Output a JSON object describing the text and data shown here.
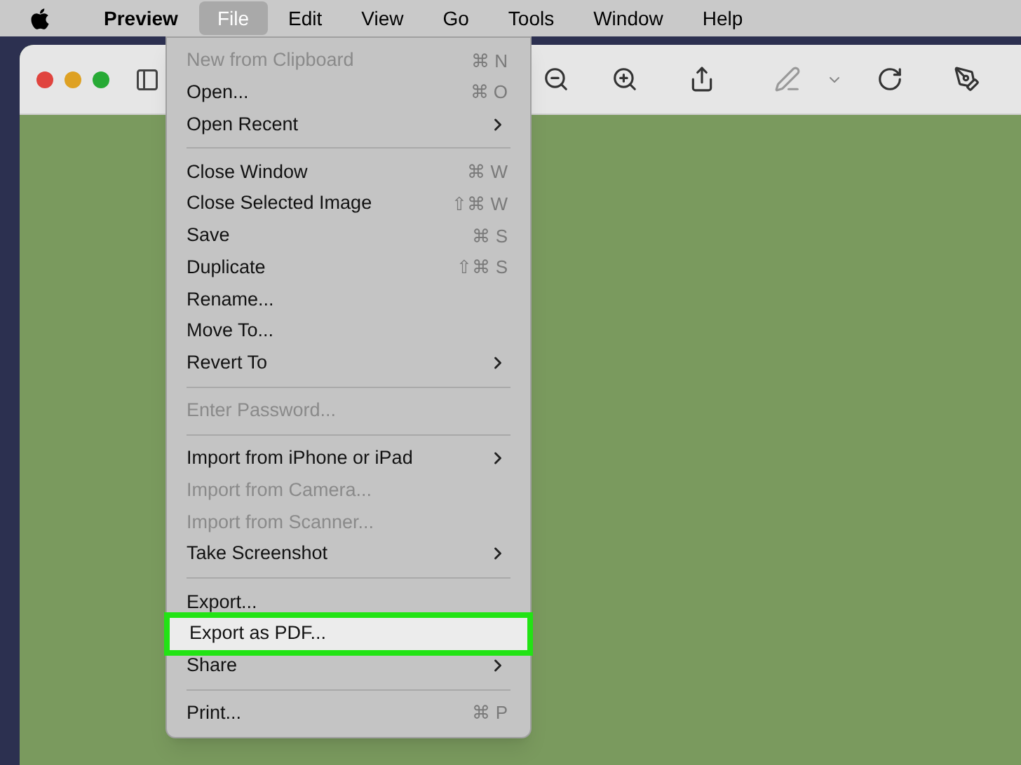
{
  "menu_bar": [
    {
      "label": "Preview",
      "kind": "app",
      "selected": false
    },
    {
      "label": "File",
      "kind": "menu",
      "selected": true
    },
    {
      "label": "Edit",
      "kind": "menu",
      "selected": false
    },
    {
      "label": "View",
      "kind": "menu",
      "selected": false
    },
    {
      "label": "Go",
      "kind": "menu",
      "selected": false
    },
    {
      "label": "Tools",
      "kind": "menu",
      "selected": false
    },
    {
      "label": "Window",
      "kind": "menu",
      "selected": false
    },
    {
      "label": "Help",
      "kind": "menu",
      "selected": false
    }
  ],
  "file_menu": [
    {
      "kind": "item",
      "label": "New from Clipboard",
      "shortcut": "⌘ N",
      "disabled": true,
      "submenu": false,
      "selected": false
    },
    {
      "kind": "item",
      "label": "Open...",
      "shortcut": "⌘ O",
      "disabled": false,
      "submenu": false,
      "selected": false
    },
    {
      "kind": "item",
      "label": "Open Recent",
      "disabled": false,
      "submenu": true,
      "selected": false
    },
    {
      "kind": "separator"
    },
    {
      "kind": "item",
      "label": "Close Window",
      "shortcut": "⌘ W",
      "disabled": false,
      "submenu": false,
      "selected": false
    },
    {
      "kind": "item",
      "label": "Close Selected Image",
      "shortcut": "⇧⌘ W",
      "disabled": false,
      "submenu": false,
      "selected": false
    },
    {
      "kind": "item",
      "label": "Save",
      "shortcut": "⌘ S",
      "disabled": false,
      "submenu": false,
      "selected": false
    },
    {
      "kind": "item",
      "label": "Duplicate",
      "shortcut": "⇧⌘ S",
      "disabled": false,
      "submenu": false,
      "selected": false
    },
    {
      "kind": "item",
      "label": "Rename...",
      "disabled": false,
      "submenu": false,
      "selected": false
    },
    {
      "kind": "item",
      "label": "Move To...",
      "disabled": false,
      "submenu": false,
      "selected": false
    },
    {
      "kind": "item",
      "label": "Revert To",
      "disabled": false,
      "submenu": true,
      "selected": false
    },
    {
      "kind": "separator"
    },
    {
      "kind": "item",
      "label": "Enter Password...",
      "disabled": true,
      "submenu": false,
      "selected": false
    },
    {
      "kind": "separator"
    },
    {
      "kind": "item",
      "label": "Import from iPhone or iPad",
      "disabled": false,
      "submenu": true,
      "selected": false
    },
    {
      "kind": "item",
      "label": "Import from Camera...",
      "disabled": true,
      "submenu": false,
      "selected": false
    },
    {
      "kind": "item",
      "label": "Import from Scanner...",
      "disabled": true,
      "submenu": false,
      "selected": false
    },
    {
      "kind": "item",
      "label": "Take Screenshot",
      "disabled": false,
      "submenu": true,
      "selected": false
    },
    {
      "kind": "separator"
    },
    {
      "kind": "item",
      "label": "Export...",
      "disabled": false,
      "submenu": false,
      "selected": false
    },
    {
      "kind": "item",
      "label": "Export as PDF...",
      "disabled": false,
      "submenu": false,
      "selected": true
    },
    {
      "kind": "item",
      "label": "Share",
      "disabled": false,
      "submenu": true,
      "selected": false
    },
    {
      "kind": "separator"
    },
    {
      "kind": "item",
      "label": "Print...",
      "shortcut": "⌘ P",
      "disabled": false,
      "submenu": false,
      "selected": false
    }
  ]
}
